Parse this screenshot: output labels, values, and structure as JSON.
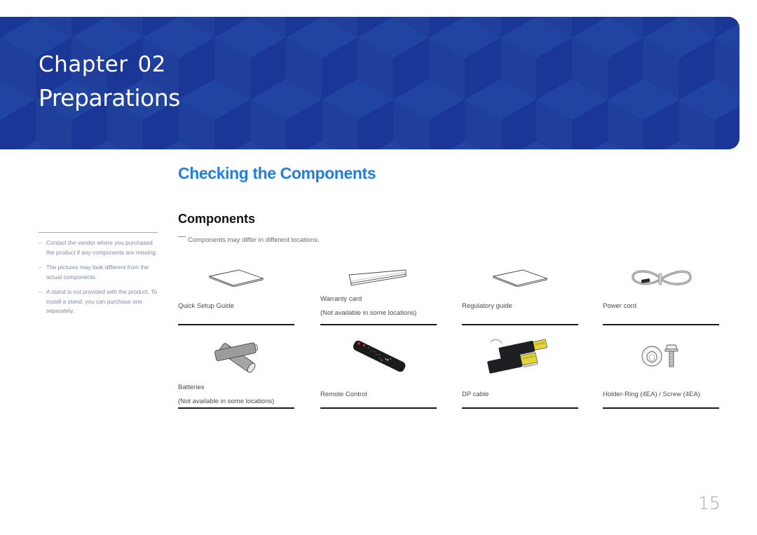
{
  "banner": {
    "chapter_label": "Chapter",
    "chapter_number": "02",
    "title": "Preparations",
    "background_color": "#1e3b96"
  },
  "section": {
    "title": "Checking the Components",
    "title_color": "#1f7fe0"
  },
  "subsection": {
    "title": "Components",
    "note": "Components may differ in different locations."
  },
  "sidebar": {
    "notes": [
      "Contact the vendor where you purchased the product if any components are missing.",
      "The pictures may look different from the actual components.",
      "A stand is not provided with the product. To install a stand, you can purchase one separately."
    ],
    "dash": "–"
  },
  "components": [
    {
      "icon": "manual-icon",
      "label": "Quick Setup Guide",
      "sublabel": ""
    },
    {
      "icon": "warranty-card-icon",
      "label": "Warranty card",
      "sublabel": "(Not available in some locations)"
    },
    {
      "icon": "manual-icon",
      "label": "Regulatory guide",
      "sublabel": ""
    },
    {
      "icon": "power-cord-icon",
      "label": "Power cord",
      "sublabel": ""
    },
    {
      "icon": "batteries-icon",
      "label": "Batteries",
      "sublabel": "(Not available in some locations)"
    },
    {
      "icon": "remote-control-icon",
      "label": "Remote Control",
      "sublabel": ""
    },
    {
      "icon": "dp-cable-icon",
      "label": "DP cable",
      "sublabel": ""
    },
    {
      "icon": "holder-ring-screw-icon",
      "label": "Holder-Ring (4EA) / Screw (4EA)",
      "sublabel": ""
    }
  ],
  "page_number": "15"
}
